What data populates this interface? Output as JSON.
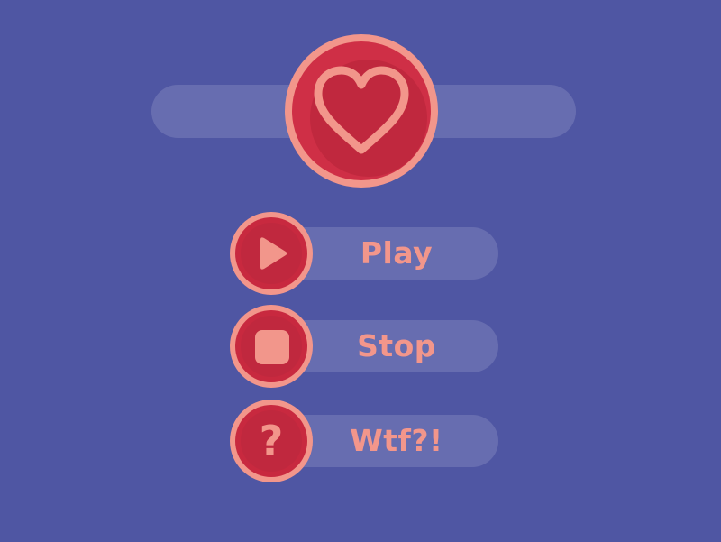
{
  "colors": {
    "background": "#4f56a3",
    "accent": "#f2968b",
    "button_red": "#c0283e"
  },
  "favorite": {
    "icon": "heart-icon"
  },
  "menu": {
    "items": [
      {
        "label": "Play",
        "icon": "play-icon"
      },
      {
        "label": "Stop",
        "icon": "stop-icon"
      },
      {
        "label": "Wtf?!",
        "icon": "question-icon"
      }
    ]
  },
  "question_glyph": "?"
}
